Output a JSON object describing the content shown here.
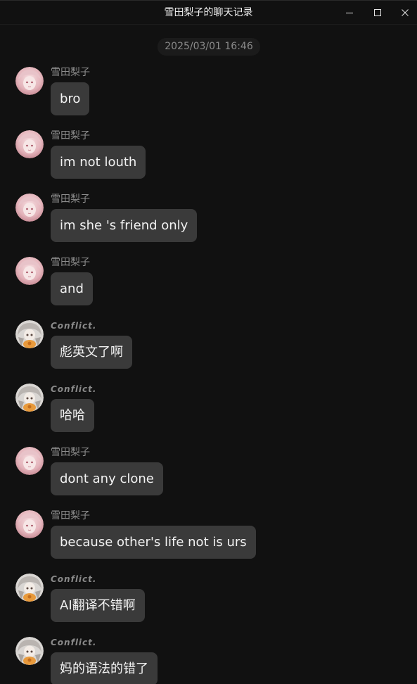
{
  "window": {
    "title": "雪田梨子的聊天记录",
    "controls": [
      "minimize-icon",
      "maximize-icon",
      "close-icon"
    ]
  },
  "timestamp": "2025/03/01 16:46",
  "colors": {
    "background": "#111111",
    "bubble": "#3a3a3a",
    "bubble_text": "#f2f2f2",
    "sender_text": "#8d8d8d"
  },
  "messages": [
    {
      "sender": "雪田梨子",
      "avatar": "pink-hair-avatar",
      "text": "bro"
    },
    {
      "sender": "雪田梨子",
      "avatar": "pink-hair-avatar",
      "text": "im not louth"
    },
    {
      "sender": "雪田梨子",
      "avatar": "pink-hair-avatar",
      "text": "im she 's friend only"
    },
    {
      "sender": "雪田梨子",
      "avatar": "pink-hair-avatar",
      "text": "and"
    },
    {
      "sender": "Conflict.",
      "avatar": "silver-hair-avatar",
      "text": "彪英文了啊"
    },
    {
      "sender": "Conflict.",
      "avatar": "silver-hair-avatar",
      "text": "哈哈"
    },
    {
      "sender": "雪田梨子",
      "avatar": "pink-hair-avatar",
      "text": "dont any clone"
    },
    {
      "sender": "雪田梨子",
      "avatar": "pink-hair-avatar",
      "text": "because other's life not is urs"
    },
    {
      "sender": "Conflict.",
      "avatar": "silver-hair-avatar",
      "text": "AI翻译不错啊"
    },
    {
      "sender": "Conflict.",
      "avatar": "silver-hair-avatar",
      "text": "妈的语法的错了"
    }
  ]
}
